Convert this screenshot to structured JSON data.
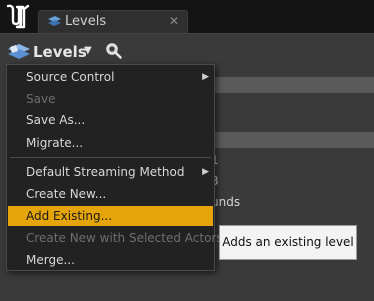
{
  "tab": {
    "label": "Levels",
    "close": "✕"
  },
  "toolbar": {
    "title": "Levels",
    "caret": "▼"
  },
  "background_rows": {
    "r1": "1",
    "r2": "3",
    "r3": "unds"
  },
  "menu": {
    "items": [
      {
        "label": "Source Control",
        "enabled": true,
        "submenu": true
      },
      {
        "label": "Save",
        "enabled": false
      },
      {
        "label": "Save As...",
        "enabled": true
      },
      {
        "label": "Migrate...",
        "enabled": true
      },
      {
        "label": "Default Streaming Method",
        "enabled": true,
        "submenu": true
      },
      {
        "label": "Create New...",
        "enabled": true
      },
      {
        "label": "Add Existing...",
        "enabled": true,
        "highlighted": true
      },
      {
        "label": "Create New with Selected Actors...",
        "enabled": false
      },
      {
        "label": "Merge...",
        "enabled": true
      }
    ],
    "submenu_arrow": "▶"
  },
  "tooltip": {
    "text": "Adds an existing level"
  },
  "colors": {
    "highlight": "#e5a50a",
    "background": "#3a3a3a",
    "menu": "#222222"
  }
}
